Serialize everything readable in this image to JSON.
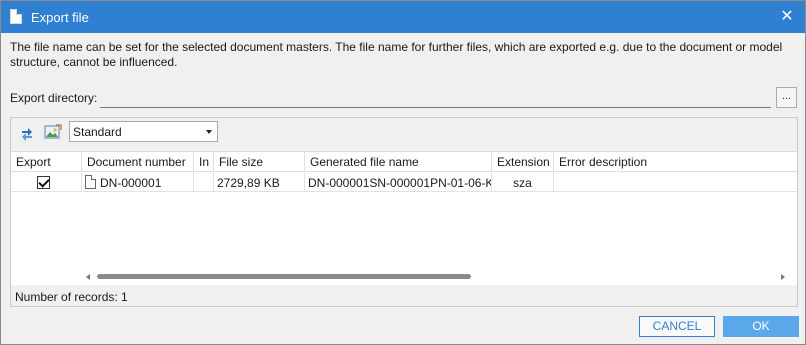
{
  "window": {
    "title": "Export file",
    "close_glyph": "✕"
  },
  "info_text": "The file name can be set for the selected document masters. The file name for further files, which are exported e.g. due to the document or model structure, cannot be influenced.",
  "export_directory": {
    "label": "Export directory:",
    "value": "",
    "browse_label": "..."
  },
  "toolbar": {
    "refresh_icon": "refresh-arrows-icon",
    "image_icon": "picture-icon",
    "view_select": {
      "selected": "Standard"
    }
  },
  "table": {
    "columns": [
      "Export",
      "Document number",
      "In",
      "File size",
      "Generated file name",
      "Extension",
      "Error description"
    ],
    "rows": [
      {
        "export_checked": true,
        "document_number": "DN-000001",
        "in": "",
        "file_size": "2729,89 KB",
        "generated_file_name": "DN-000001SN-000001PN-01-06-K",
        "extension": "sza",
        "error_description": ""
      }
    ]
  },
  "status": {
    "records": "Number of records: 1"
  },
  "buttons": {
    "cancel": "CANCEL",
    "ok": "OK"
  },
  "colors": {
    "titlebar": "#2f80d1",
    "ok_button": "#5aa7ea",
    "dialog_bg": "#f0f0f0"
  }
}
